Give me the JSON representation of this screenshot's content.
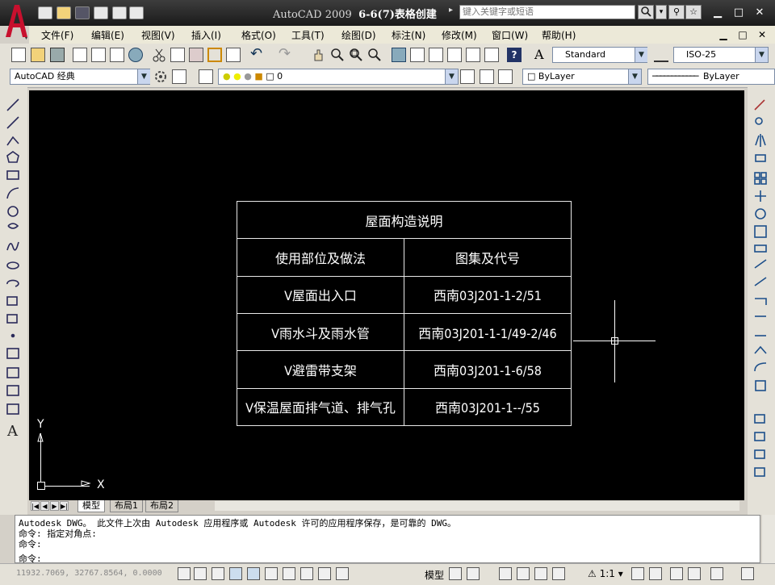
{
  "window": {
    "app_name": "AutoCAD 2009",
    "document_name": "6-6(7)表格创建",
    "search_placeholder": "键入关键字或短语",
    "minimize": "▁",
    "restore": "□",
    "close": "✕"
  },
  "menu": {
    "items": [
      {
        "label": "文件(F)"
      },
      {
        "label": "编辑(E)"
      },
      {
        "label": "视图(V)"
      },
      {
        "label": "插入(I)"
      },
      {
        "label": "格式(O)"
      },
      {
        "label": "工具(T)"
      },
      {
        "label": "绘图(D)"
      },
      {
        "label": "标注(N)"
      },
      {
        "label": "修改(M)"
      },
      {
        "label": "窗口(W)"
      },
      {
        "label": "帮助(H)"
      }
    ]
  },
  "toolbar": {
    "text_style": "Standard",
    "dim_style": "ISO-25",
    "workspace": "AutoCAD 经典",
    "layer": "0",
    "color": "ByLayer",
    "linetype": "ByLayer",
    "help_label": "?"
  },
  "table": {
    "title": "屋面构造说明",
    "headers": [
      "使用部位及做法",
      "图集及代号"
    ],
    "rows": [
      [
        "V屋面出入口",
        "西南03J201-1-2/51"
      ],
      [
        "V雨水斗及雨水管",
        "西南03J201-1-1/49-2/46"
      ],
      [
        "V避雷带支架",
        "西南03J201-1-6/58"
      ],
      [
        "V保温屋面排气道、排气孔",
        "西南03J201-1--/55"
      ]
    ]
  },
  "ucs": {
    "x_label": "X",
    "y_label": "Y"
  },
  "tabs": {
    "model": "模型",
    "layout1": "布局1",
    "layout2": "布局2"
  },
  "command": {
    "lines": [
      "Autodesk DWG。  此文件上次由 Autodesk 应用程序或 Autodesk 许可的应用程序保存，是可靠的 DWG。",
      "命令: 指定对角点:",
      "命令:",
      "命令:"
    ]
  },
  "status": {
    "coordinates": "11932.7069, 32767.8564, 0.0000",
    "model_label": "模型",
    "scale": "1:1"
  },
  "colors": {
    "canvas": "#000000",
    "title_bar": "#2a2a2a",
    "logo_red": "#c8102e"
  }
}
